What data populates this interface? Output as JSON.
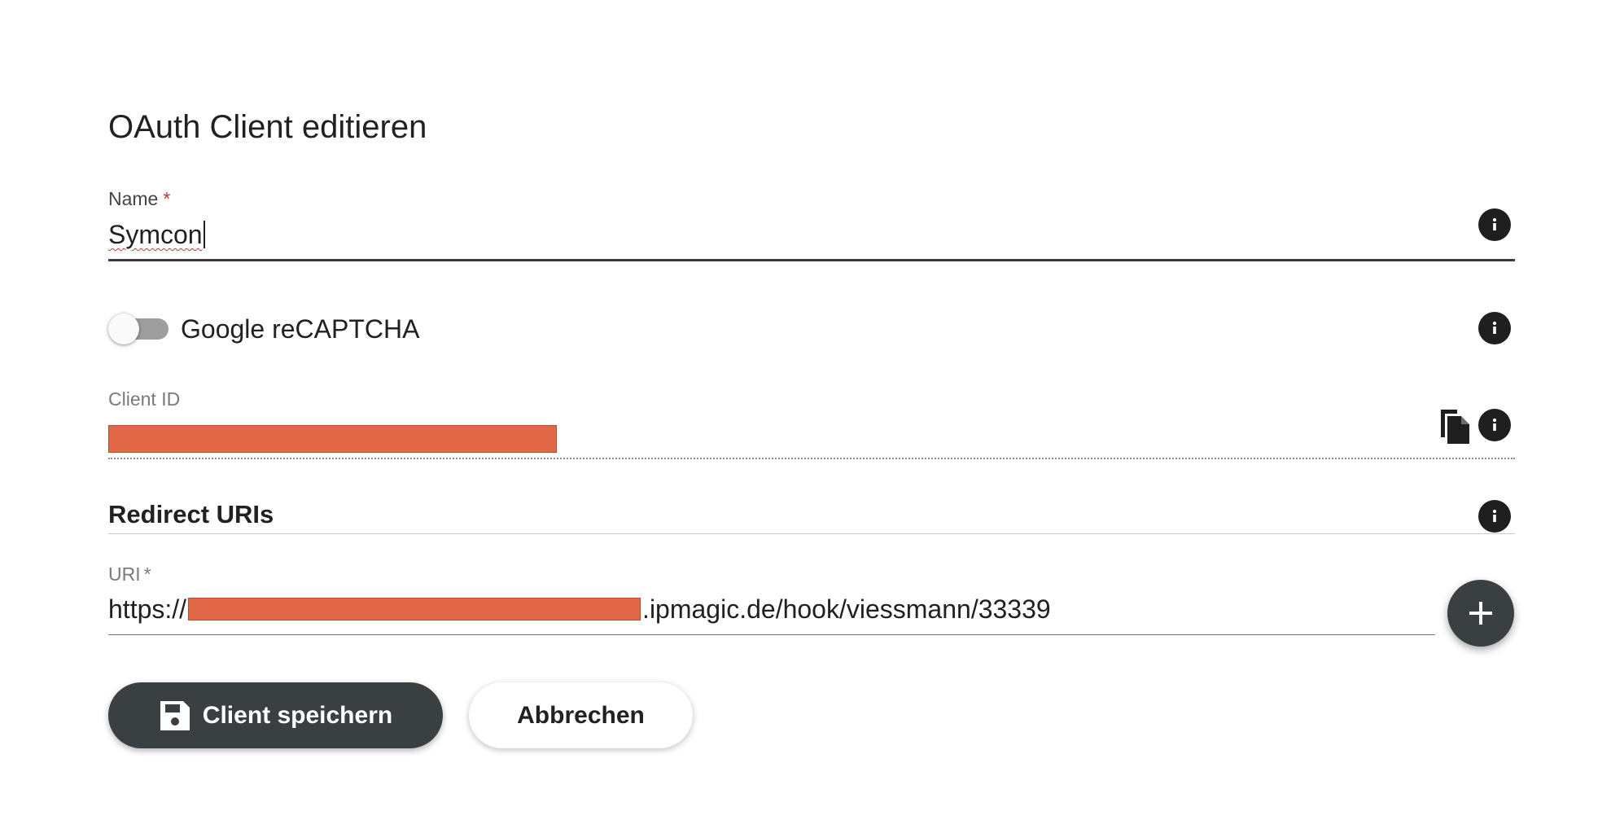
{
  "dialog": {
    "title": "OAuth Client editieren"
  },
  "name_field": {
    "label": "Name",
    "required_mark": "*",
    "value": "Symcon"
  },
  "recaptcha": {
    "label": "Google reCAPTCHA",
    "enabled": false
  },
  "client_id": {
    "label": "Client ID",
    "value_redacted": true
  },
  "redirect_uris": {
    "section_title": "Redirect URIs",
    "uri_label": "URI",
    "required_mark": "*",
    "uri_prefix": "https://",
    "uri_suffix": ".ipmagic.de/hook/viessmann/33339"
  },
  "actions": {
    "save_label": "Client speichern",
    "cancel_label": "Abbrechen"
  },
  "icons": {
    "info": "info-icon",
    "copy": "copy-icon",
    "add": "plus-icon",
    "save": "floppy-disk-icon"
  },
  "colors": {
    "primary_button": "#3a3f41",
    "redaction": "#e06847",
    "required": "#d32f2f"
  }
}
